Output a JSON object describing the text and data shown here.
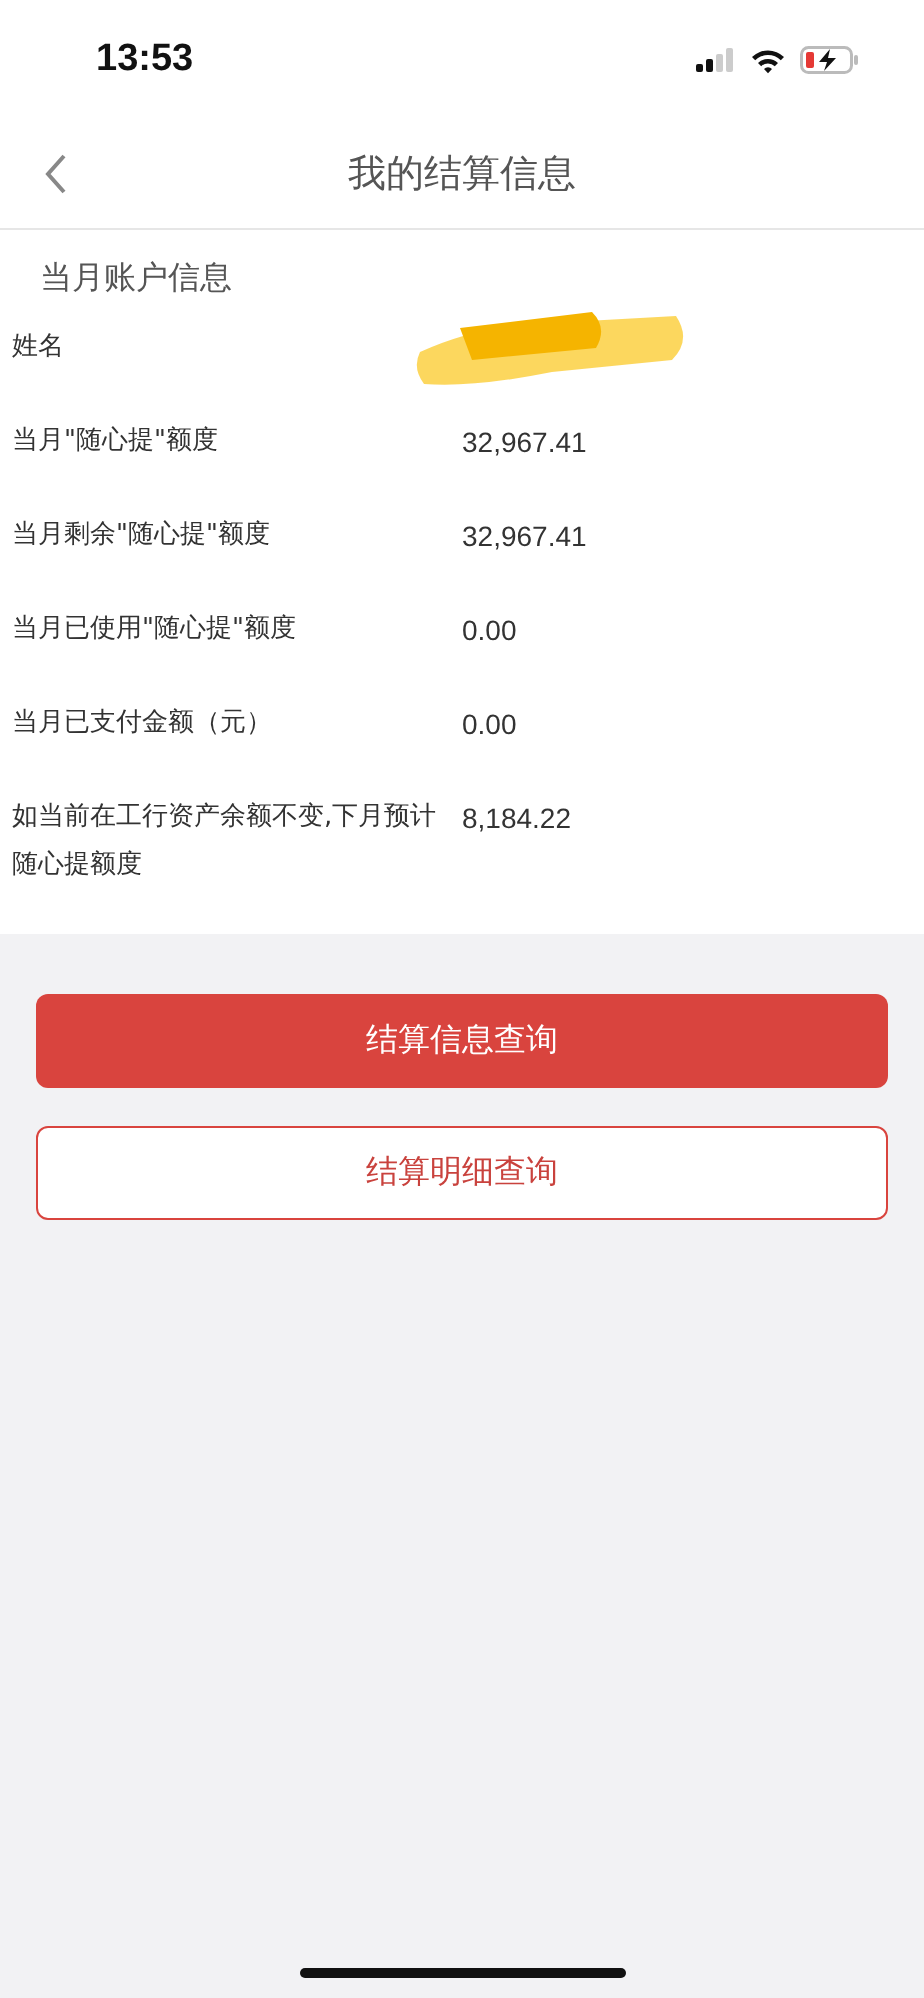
{
  "status_bar": {
    "time": "13:53"
  },
  "nav": {
    "title": "我的结算信息"
  },
  "section": {
    "title": "当月账户信息"
  },
  "rows": [
    {
      "label": "姓名",
      "kind": "redacted"
    },
    {
      "label": "当月\"随心提\"额度",
      "kind": "value",
      "value": "32,967.41"
    },
    {
      "label": "当月剩余\"随心提\"额度",
      "kind": "value",
      "value": "32,967.41"
    },
    {
      "label": "当月已使用\"随心提\"额度",
      "kind": "value",
      "value": "0.00"
    },
    {
      "label": "当月已支付金额（元）",
      "kind": "value",
      "value": "0.00"
    },
    {
      "label": "如当前在工行资产余额不变,下月预计随心提额度",
      "kind": "value",
      "value": "8,184.22"
    }
  ],
  "buttons": [
    {
      "label": "结算信息查询",
      "kind": "primary"
    },
    {
      "label": "结算明细查询",
      "kind": "outline"
    }
  ]
}
